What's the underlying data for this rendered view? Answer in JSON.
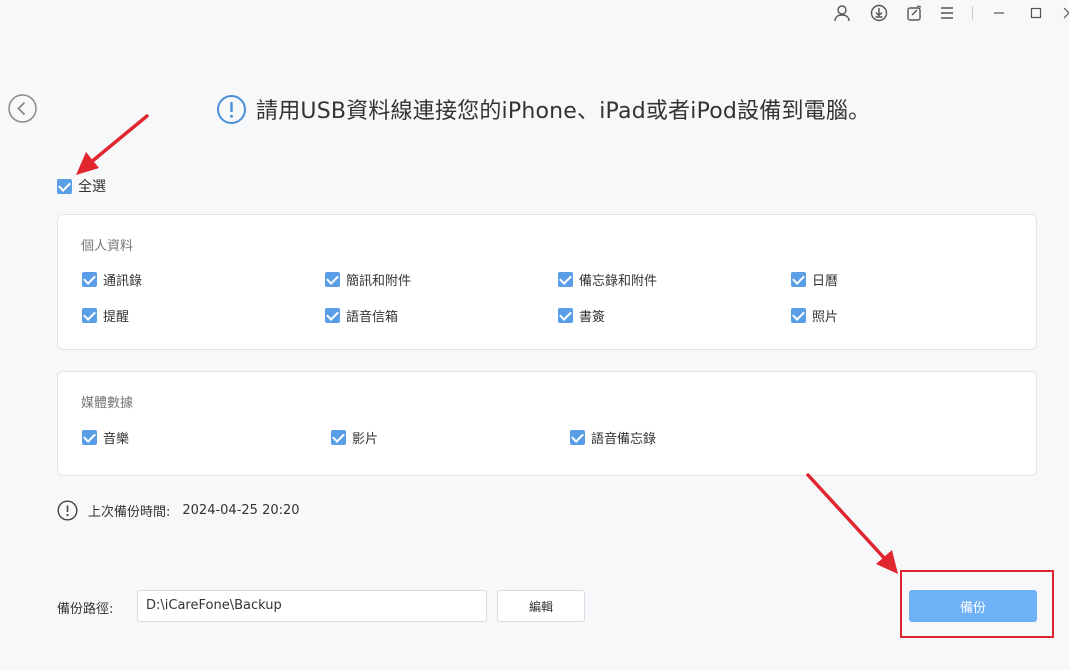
{
  "header": {
    "title": "請用USB資料線連接您的iPhone、iPad或者iPod設備到電腦。"
  },
  "select_all": {
    "label": "全選",
    "checked": true
  },
  "personal": {
    "title": "個人資料",
    "items": [
      {
        "label": "通訊錄",
        "checked": true
      },
      {
        "label": "簡訊和附件",
        "checked": true
      },
      {
        "label": "備忘錄和附件",
        "checked": true
      },
      {
        "label": "日曆",
        "checked": true
      },
      {
        "label": "提醒",
        "checked": true
      },
      {
        "label": "語音信箱",
        "checked": true
      },
      {
        "label": "書簽",
        "checked": true
      },
      {
        "label": "照片",
        "checked": true
      }
    ]
  },
  "media": {
    "title": "媒體數據",
    "items": [
      {
        "label": "音樂",
        "checked": true
      },
      {
        "label": "影片",
        "checked": true
      },
      {
        "label": "語音備忘錄",
        "checked": true
      }
    ]
  },
  "last_backup": {
    "label": "上次備份時間:",
    "value": "2024-04-25 20:20"
  },
  "backup_path": {
    "label": "備份路徑:",
    "value": "D:\\iCareFone\\Backup",
    "edit_label": "編輯"
  },
  "backup_button": {
    "label": "備份"
  },
  "colors": {
    "accent": "#5a9ee8",
    "button": "#6eb1f7",
    "annotation": "#e0262e"
  },
  "titlebar_icons": [
    "user-icon",
    "download-icon",
    "feedback-icon",
    "menu-icon",
    "minimize-icon",
    "maximize-icon",
    "close-icon"
  ]
}
